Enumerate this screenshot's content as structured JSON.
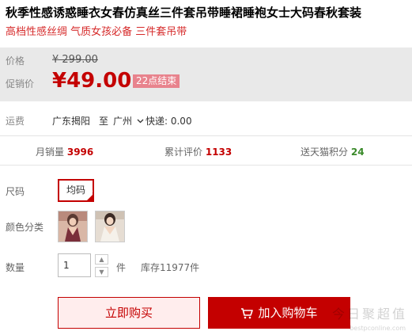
{
  "product": {
    "title": "秋季性感诱惑睡衣女春仿真丝三件套吊带睡裙睡袍女士大码春秋套装",
    "subtitle": "高档性感丝绸  气质女孩必备  三件套吊带"
  },
  "price": {
    "original_label": "价格",
    "original_value": "¥ 299.00",
    "promo_label": "促销价",
    "promo_value": "¥49.00",
    "promo_badge": "22点结束"
  },
  "shipping": {
    "label": "运费",
    "from": "广东揭阳",
    "to_prefix": "至",
    "to_city": "广州",
    "method": "快递: 0.00"
  },
  "stats": {
    "monthly_sales_label": "月销量",
    "monthly_sales_value": "3996",
    "reviews_label": "累计评价",
    "reviews_value": "1133",
    "points_label": "送天猫积分",
    "points_value": "24"
  },
  "options": {
    "size_label": "尺码",
    "size_selected": "均码",
    "color_label": "颜色分类",
    "quantity_label": "数量",
    "quantity_value": "1",
    "quantity_unit": "件",
    "stock": "库存11977件"
  },
  "actions": {
    "buy_now": "立即购买",
    "add_to_cart": "加入购物车"
  },
  "watermark": {
    "text": "今日聚超值",
    "url": "bestpconline.com"
  },
  "colors": {
    "accent": "#c40000",
    "badge": "#e8838d",
    "price_bg": "#e9e9e9"
  }
}
